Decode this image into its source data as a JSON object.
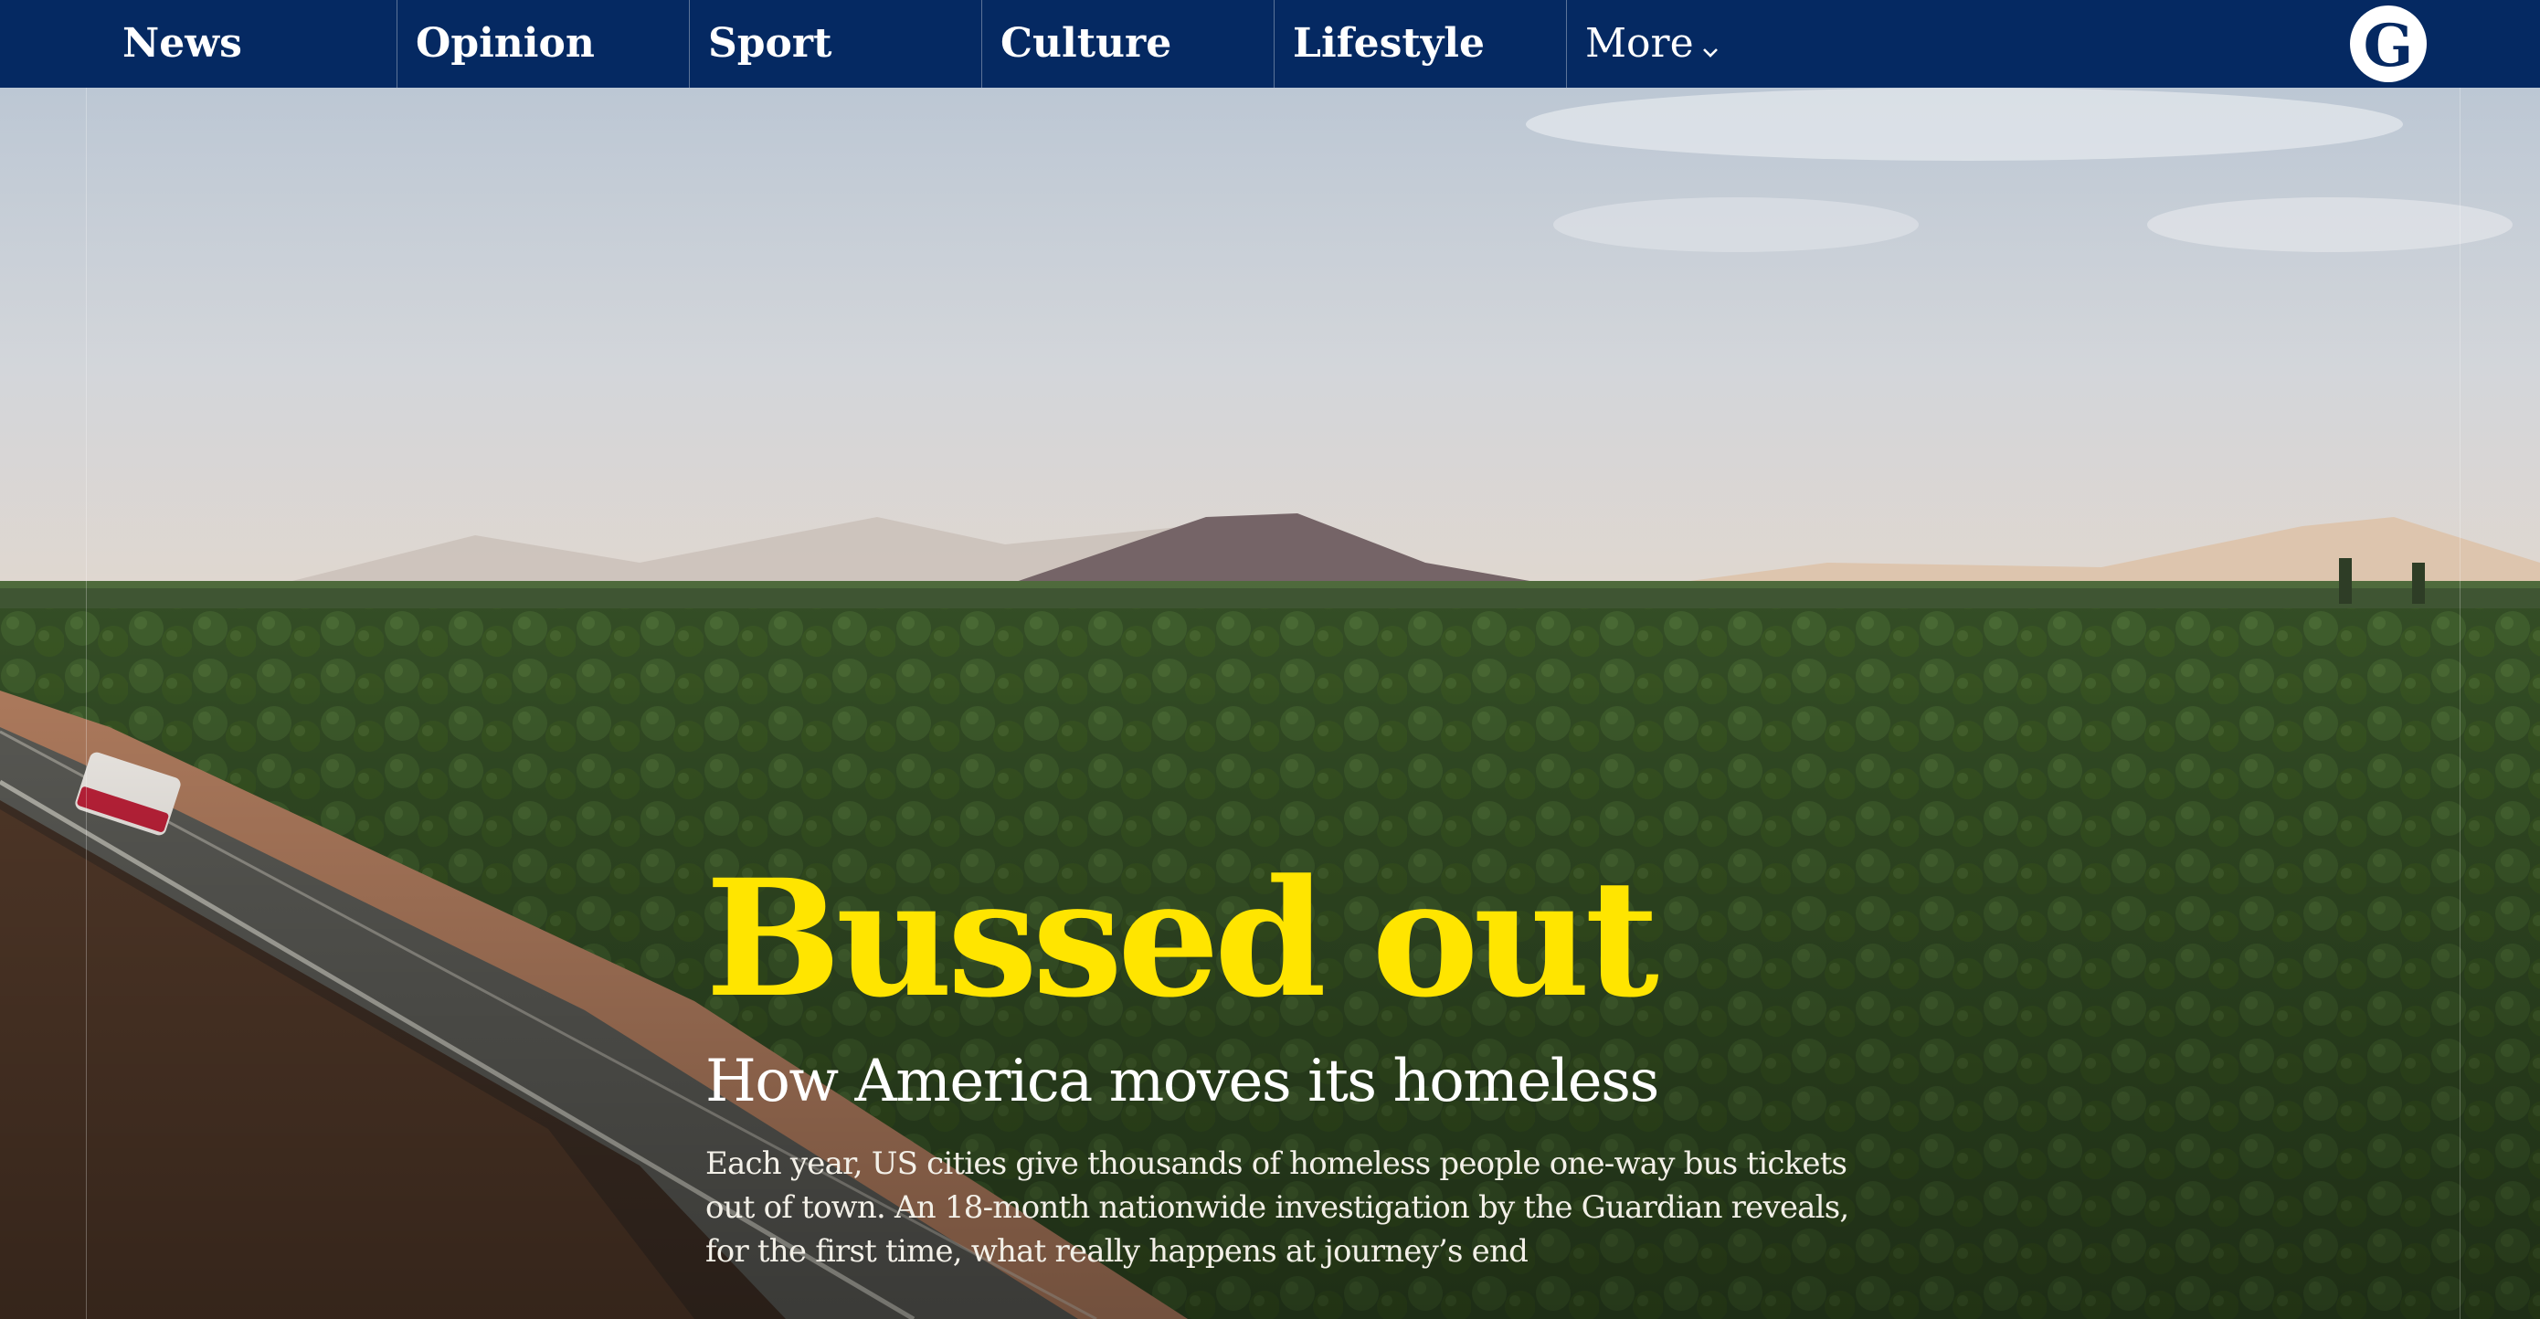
{
  "nav": {
    "items": [
      {
        "label": "News"
      },
      {
        "label": "Opinion"
      },
      {
        "label": "Sport"
      },
      {
        "label": "Culture"
      },
      {
        "label": "Lifestyle"
      }
    ],
    "more_label": "More",
    "logo_letter": "G"
  },
  "hero": {
    "headline": "Bussed out",
    "standfirst": "How America moves its homeless",
    "intro": "Each year, US cities give thousands of homeless people one-way bus tickets out of town. An 18-month nationwide investigation by the Guardian reveals, for the first time, what really happens at journey’s end"
  },
  "colors": {
    "nav_background": "#052962",
    "headline_yellow": "#ffe500",
    "text_white": "#ffffff"
  },
  "icons": [
    "chevron-down-icon",
    "guardian-logo-icon"
  ]
}
